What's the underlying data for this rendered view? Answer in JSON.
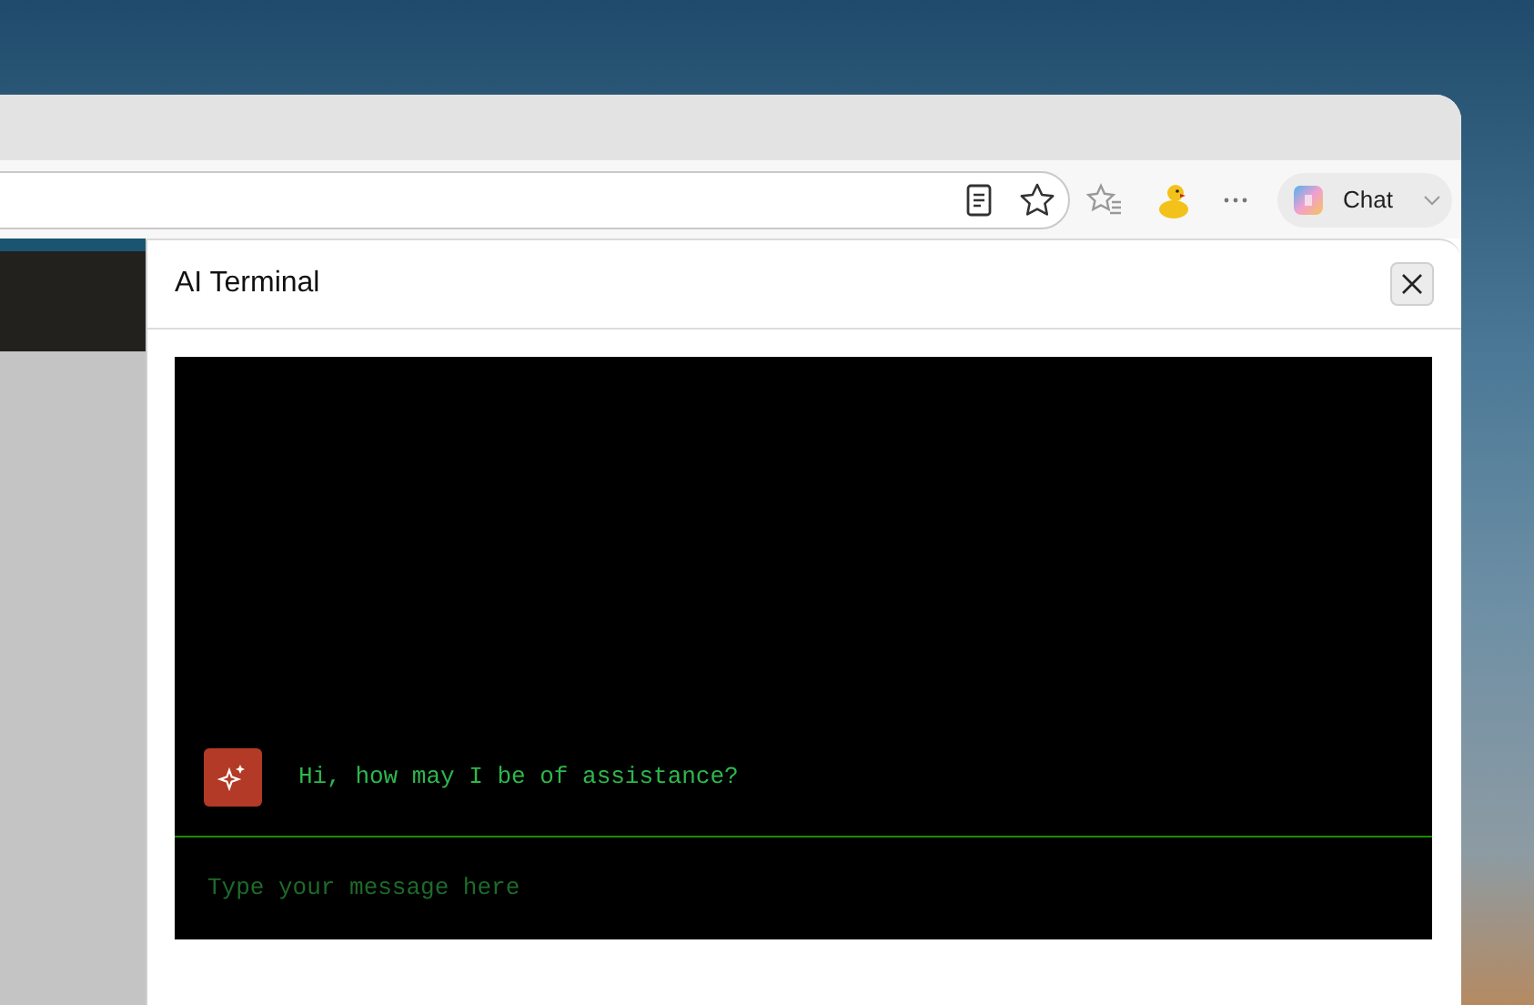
{
  "toolbar": {
    "chat_button": "Chat"
  },
  "panel": {
    "title": "AI Terminal",
    "messages": [
      {
        "text": "Hi, how may I be of assistance?"
      }
    ],
    "input": {
      "placeholder": "Type your message here"
    }
  }
}
